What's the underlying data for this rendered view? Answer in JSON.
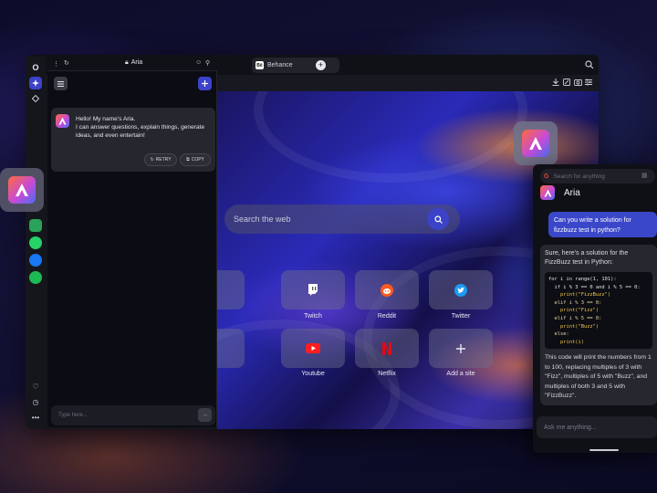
{
  "browser": {
    "address_text": "Aria",
    "tab_behance": "Behance",
    "new_tab": "+"
  },
  "aria_panel": {
    "greeting_title": "Hello! My name's Aria.",
    "greeting_body": "I can answer questions, explain things, generate ideas, and even entertain!",
    "retry_label": "RETRY",
    "copy_label": "COPY",
    "input_placeholder": "Type here..."
  },
  "start_page": {
    "search_placeholder": "Search the web",
    "dials": [
      {
        "label": "m",
        "icon": "partial-icon"
      },
      {
        "label": "Twitch",
        "icon": "twitch-icon"
      },
      {
        "label": "Reddit",
        "icon": "reddit-icon"
      },
      {
        "label": "Twitter",
        "icon": "twitter-icon"
      },
      {
        "label": "b",
        "icon": "partial-icon"
      },
      {
        "label": "Youtube",
        "icon": "youtube-icon"
      },
      {
        "label": "Netflix",
        "icon": "netflix-icon"
      },
      {
        "label": "Add a site",
        "icon": "plus-icon"
      }
    ]
  },
  "phone": {
    "search_placeholder": "Search for anything",
    "title": "Aria",
    "user_message": "Can you write a solution for fizzbuzz test in python?",
    "bot_intro": "Sure, here's a solution for the FizzBuzz test in Python:",
    "code_lines": [
      "for i in range(1, 101):",
      "  if i % 3 == 0 and i % 5 == 0:",
      "    print(\"FizzBuzz\")",
      "  elif i % 3 == 0:",
      "    print(\"Fizz\")",
      "  elif i % 5 == 0:",
      "    print(\"Buzz\")",
      "  else:",
      "    print(i)"
    ],
    "bot_outro": "This code will print the numbers from 1 to 100, replacing multiples of 3 with \"Fizz\", multiples of 5 with \"Buzz\", and multiples of both 3 and 5 with \"FizzBuzz\".",
    "input_placeholder": "Ask me anything..."
  },
  "colors": {
    "accent": "#3c43c8",
    "aria_gradient_start": "#ff6b3d",
    "aria_gradient_end": "#4b6cf2"
  }
}
